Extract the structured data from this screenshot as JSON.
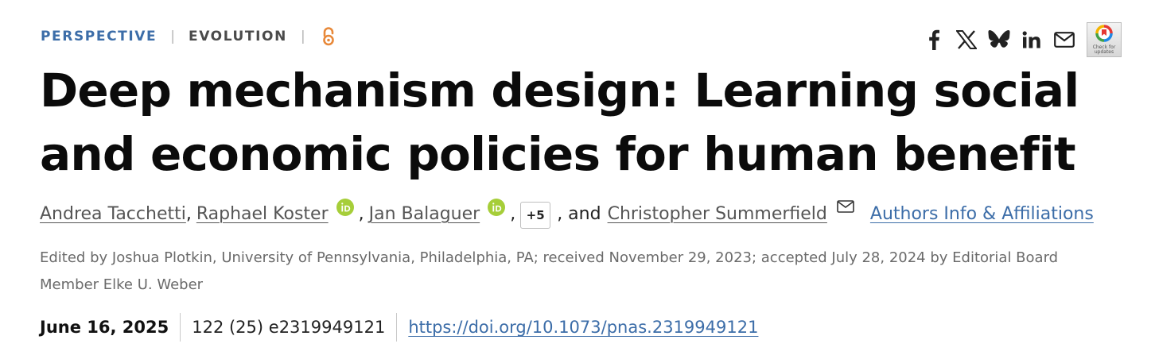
{
  "article": {
    "type": "PERSPECTIVE",
    "subject": "EVOLUTION",
    "separator": "|",
    "open_access_icon": "open-access-icon",
    "title": "Deep mechanism design: Learning social and economic policies for human benefit",
    "authors": [
      {
        "name": "Andrea Tacchetti",
        "orcid": false
      },
      {
        "name": "Raphael Koster",
        "orcid": true
      },
      {
        "name": "Jan Balaguer",
        "orcid": true
      },
      {
        "name": "Christopher Summerfield",
        "orcid": false,
        "corresponding": true
      }
    ],
    "more_authors": "+5",
    "and_text": ", and",
    "comma": ",",
    "affiliations_link": "Authors Info & Affiliations",
    "edited_by": "Edited by Joshua Plotkin, University of Pennsylvania, Philadelphia, PA; received November 29, 2023; accepted July 28, 2024 by Editorial Board Member Elke U. Weber",
    "date": "June 16, 2025",
    "citation": "122 (25) e2319949121",
    "doi": "https://doi.org/10.1073/pnas.2319949121"
  },
  "share": {
    "icons": [
      "facebook-icon",
      "x-icon",
      "bluesky-icon",
      "linkedin-icon",
      "email-icon"
    ],
    "check_for_updates": "Check for updates"
  },
  "colors": {
    "accent_blue": "#3c6da8",
    "open_access_orange": "#e8893a",
    "orcid_green": "#a6ce39"
  }
}
